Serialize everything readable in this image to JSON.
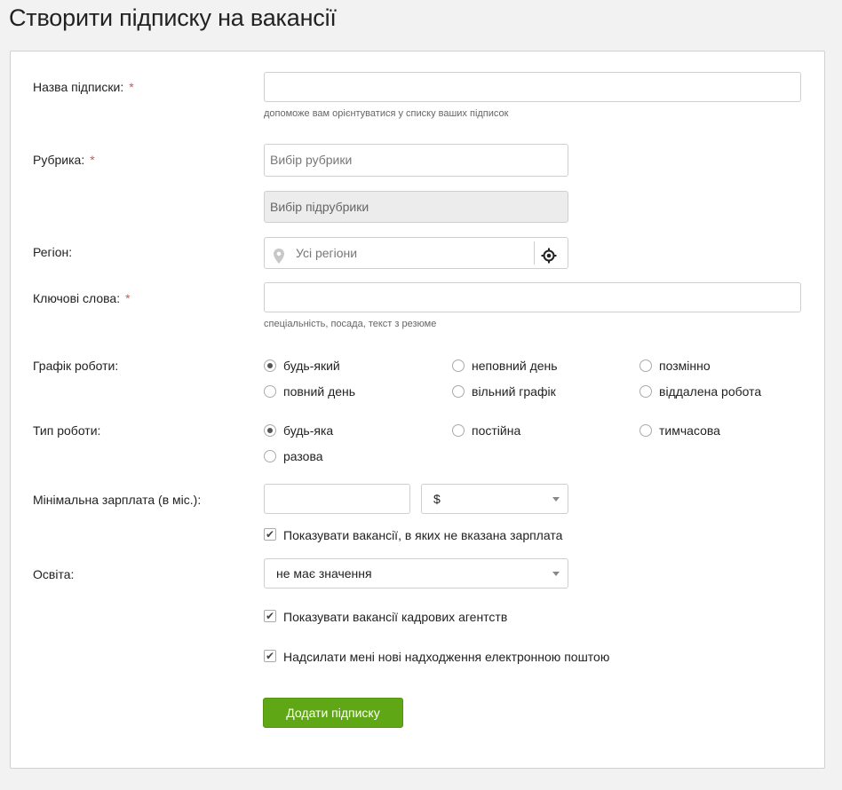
{
  "title": "Створити підписку на вакансії",
  "form": {
    "name": {
      "label": "Назва підписки:",
      "required": "*",
      "value": "",
      "hint": "допоможе вам орієнтуватися у списку ваших підписок"
    },
    "category": {
      "label": "Рубрика:",
      "required": "*",
      "placeholder": "Вибір рубрики",
      "sub_placeholder": "Вибір підрубрики"
    },
    "region": {
      "label": "Регіон:",
      "placeholder": "Усі регіони",
      "icons": [
        "map-pin-icon",
        "geolocate-icon"
      ]
    },
    "keywords": {
      "label": "Ключові слова:",
      "required": "*",
      "value": "",
      "hint": "спеціальність, посада, текст з резюме"
    },
    "schedule": {
      "label": "Графік роботи:",
      "options": [
        "будь-який",
        "неповний день",
        "позмінно",
        "повний день",
        "вільний графік",
        "віддалена робота"
      ],
      "selected": "будь-який"
    },
    "work_type": {
      "label": "Тип роботи:",
      "options": [
        "будь-яка",
        "постійна",
        "тимчасова",
        "разова"
      ],
      "selected": "будь-яка"
    },
    "salary": {
      "label": "Мінімальна зарплата (в міс.):",
      "value": "",
      "currency": "$",
      "show_unspecified": {
        "label": "Показувати вакансії, в яких не вказана зарплата",
        "checked": true
      }
    },
    "education": {
      "label": "Освіта:",
      "value": "не має значення"
    },
    "agencies": {
      "label": "Показувати вакансії кадрових агентств",
      "checked": true
    },
    "email": {
      "label": "Надсилати мені нові надходження електронною поштою",
      "checked": true
    },
    "submit_label": "Додати підписку"
  },
  "colors": {
    "accent": "#5fa715",
    "required": "#d9534f"
  }
}
